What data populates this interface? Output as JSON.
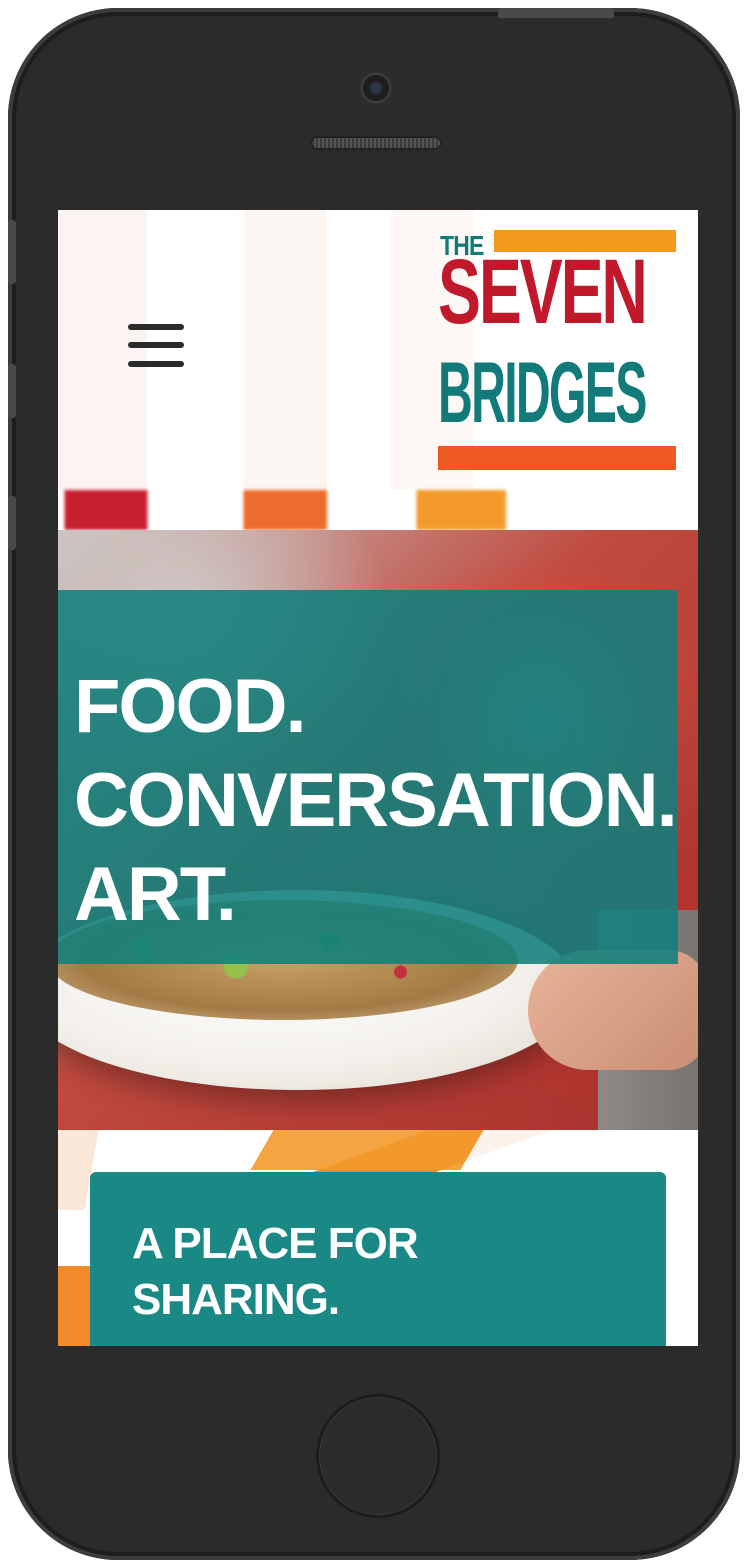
{
  "logo": {
    "the": "THE",
    "seven": "SEVEN",
    "bridges": "BRIDGES"
  },
  "hero": {
    "lines": [
      "FOOD.",
      "CONVERSATION.",
      "ART."
    ]
  },
  "section": {
    "lines": [
      "A PLACE FOR",
      "SHARING."
    ]
  },
  "colors": {
    "teal": "#1a8884",
    "red": "#c0192b",
    "orange": "#f05a22",
    "amber": "#f39a1e"
  },
  "icons": {
    "menu": "hamburger-menu-icon"
  }
}
